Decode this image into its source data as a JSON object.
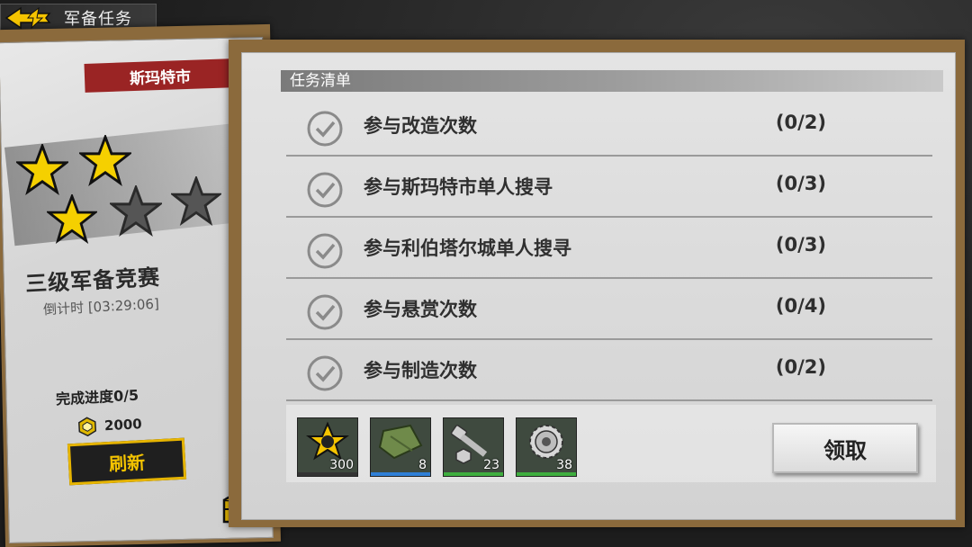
{
  "header": {
    "title": "军备任务"
  },
  "left_card": {
    "city": "斯玛特市",
    "stars_filled": 3,
    "stars_total": 5,
    "rank_title": "三级军备竞赛",
    "countdown": "倒计时 [03:29:06]",
    "progress": "完成进度0/5",
    "coin_amount": "2000",
    "refresh_label": "刷新"
  },
  "task_list": {
    "header": "任务清单",
    "tasks": [
      {
        "label": "参与改造次数",
        "progress": "(0/2)"
      },
      {
        "label": "参与斯玛特市单人搜寻",
        "progress": "(0/3)"
      },
      {
        "label": "参与利伯塔尔城单人搜寻",
        "progress": "(0/3)"
      },
      {
        "label": "参与悬赏次数",
        "progress": "(0/4)"
      },
      {
        "label": "参与制造次数",
        "progress": "(0/2)"
      }
    ]
  },
  "rewards": [
    {
      "icon": "sheriff-badge-icon",
      "count": "300",
      "bar_color": "#333333"
    },
    {
      "icon": "cloth-icon",
      "count": "8",
      "bar_color": "#2f7fd6"
    },
    {
      "icon": "bolt-nut-icon",
      "count": "23",
      "bar_color": "#3fae3f"
    },
    {
      "icon": "gear-icon",
      "count": "38",
      "bar_color": "#3fae3f"
    }
  ],
  "claim_label": "领取",
  "colors": {
    "city_tag": "#9a2424",
    "star_gold": "#f5d000",
    "star_empty": "#555555",
    "refresh_border": "#e6b400"
  }
}
